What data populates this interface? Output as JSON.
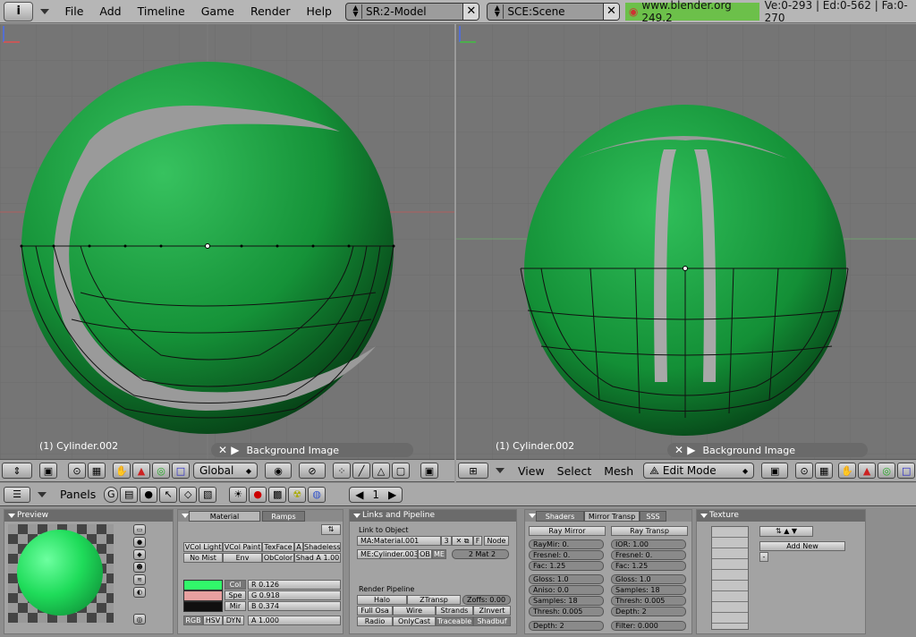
{
  "topbar": {
    "info_icon": "i",
    "menus": [
      "File",
      "Add",
      "Timeline",
      "Game",
      "Render",
      "Help"
    ],
    "screen_field": "SR:2-Model",
    "scene_field": "SCE:Scene",
    "url": "www.blender.org 249.2",
    "stats": "Ve:0-293 | Ed:0-562 | Fa:0-270"
  },
  "viewport_left": {
    "object_label": "(1) Cylinder.002",
    "bg_image_label": "Background Image",
    "header": {
      "orientation": "Global"
    }
  },
  "viewport_right": {
    "object_label": "(1) Cylinder.002",
    "bg_image_label": "Background Image",
    "header": {
      "menus": [
        "View",
        "Select",
        "Mesh"
      ],
      "mode": "Edit Mode"
    }
  },
  "buttons_header": {
    "panels_label": "Panels",
    "frame": "1"
  },
  "panels": {
    "preview": {
      "title": "Preview"
    },
    "material": {
      "tabs": [
        "Material",
        "Ramps"
      ],
      "row1": [
        "VCol Light",
        "VCol Paint",
        "TexFace",
        "A",
        "Shadeless"
      ],
      "row2": [
        "No Mist",
        "Env",
        "ObColor",
        "Shad A 1.00"
      ],
      "color_tabs": [
        "Col",
        "Spe",
        "Mir"
      ],
      "rgb": [
        "R 0.126",
        "G 0.918",
        "B 0.374"
      ],
      "modes": [
        "RGB",
        "HSV",
        "DYN"
      ],
      "alpha": "A 1.000",
      "col_color": "#31f86a",
      "spe_color": "#e8a0a0",
      "mir_color": "#101010"
    },
    "links": {
      "title": "Links and Pipeline",
      "link_to_object": "Link to Object",
      "material_name": "MA:Material.001",
      "users": "3",
      "f_label": "F",
      "node": "Node",
      "mesh_name": "ME:Cylinder.003",
      "ob_label": "OB",
      "me_label": "ME",
      "mat_count": "2 Mat 2",
      "render_pipeline": "Render Pipeline",
      "pipeline_rows": [
        [
          "Halo",
          "ZTransp",
          "Zoffs: 0.00"
        ],
        [
          "Full Osa",
          "Wire",
          "Strands",
          "ZInvert"
        ],
        [
          "Radio",
          "OnlyCast",
          "Traceable",
          "Shadbuf"
        ]
      ]
    },
    "shaders": {
      "tabs": [
        "Shaders",
        "Mirror Transp",
        "SSS"
      ],
      "ray_mirror": "Ray Mirror",
      "ray_transp": "Ray Transp",
      "left": [
        "RayMir: 0.",
        "Fresnel: 0.",
        "Fac: 1.25",
        "Gloss: 1.0",
        "Aniso: 0.0",
        "Samples: 18",
        "Thresh: 0.005",
        "Depth: 2"
      ],
      "right": [
        "IOR: 1.00",
        "Fresnel: 0.",
        "Fac: 1.25",
        "Gloss: 1.0",
        "Samples: 18",
        "Thresh: 0.005",
        "Depth: 2",
        "Filter: 0.000"
      ]
    },
    "texture": {
      "title": "Texture",
      "add_new": "Add New"
    }
  },
  "colors": {
    "viewport_bg": "#757575",
    "mesh_green": "#1a9a3c",
    "accent_green": "#6cc04a"
  }
}
